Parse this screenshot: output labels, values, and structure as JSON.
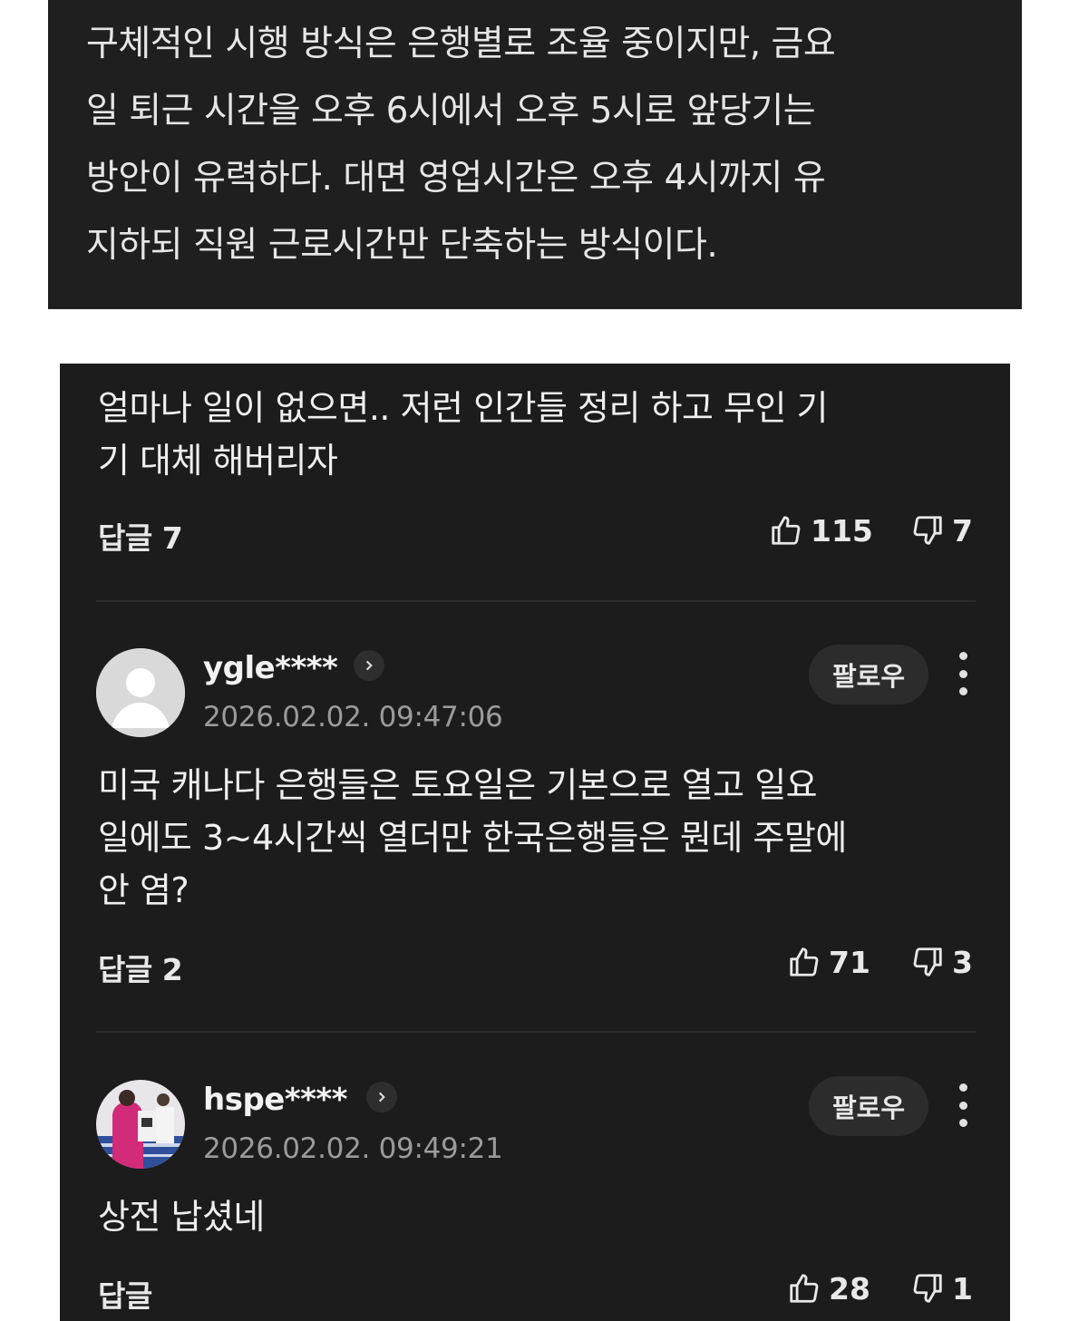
{
  "article": {
    "lines": [
      "구체적인 시행 방식은 은행별로 조율 중이지만, 금요",
      "일 퇴근 시간을 오후 6시에서 오후 5시로 앞당기는",
      "방안이 유력하다. 대면 영업시간은 오후 4시까지 유",
      "지하되 직원 근로시간만 단축하는 방식이다."
    ]
  },
  "comments": [
    {
      "text_lines": [
        "얼마나 일이 없으면.. 저런 인간들 정리 하고 무인 기",
        "기 대체 해버리자"
      ],
      "reply_label": "답글 7",
      "likes": "115",
      "dislikes": "7"
    },
    {
      "username": "ygle****",
      "timestamp": "2026.02.02. 09:47:06",
      "follow_label": "팔로우",
      "avatar": "default-avatar-icon",
      "text_lines": [
        "미국 캐나다 은행들은 토요일은 기본으로 열고 일요",
        "일에도 3~4시간씩 열더만 한국은행들은 뭔데 주말에",
        "안 염?"
      ],
      "reply_label": "답글 2",
      "likes": "71",
      "dislikes": "3"
    },
    {
      "username": "hspe****",
      "timestamp": "2026.02.02. 09:49:21",
      "follow_label": "팔로우",
      "avatar": "photo-avatar",
      "text_lines": [
        "상전 납셨네"
      ],
      "reply_label": "답글",
      "likes": "28",
      "dislikes": "1"
    }
  ],
  "icons": {
    "like": "thumbs-up-icon",
    "dislike": "thumbs-down-icon",
    "profile_link": "chevron-right-icon",
    "more": "more-vertical-icon"
  },
  "colors": {
    "article_bg": "#1f1f1f",
    "comments_bg": "#1c1c1c",
    "text": "#efefef",
    "muted": "#9b9b9b"
  }
}
